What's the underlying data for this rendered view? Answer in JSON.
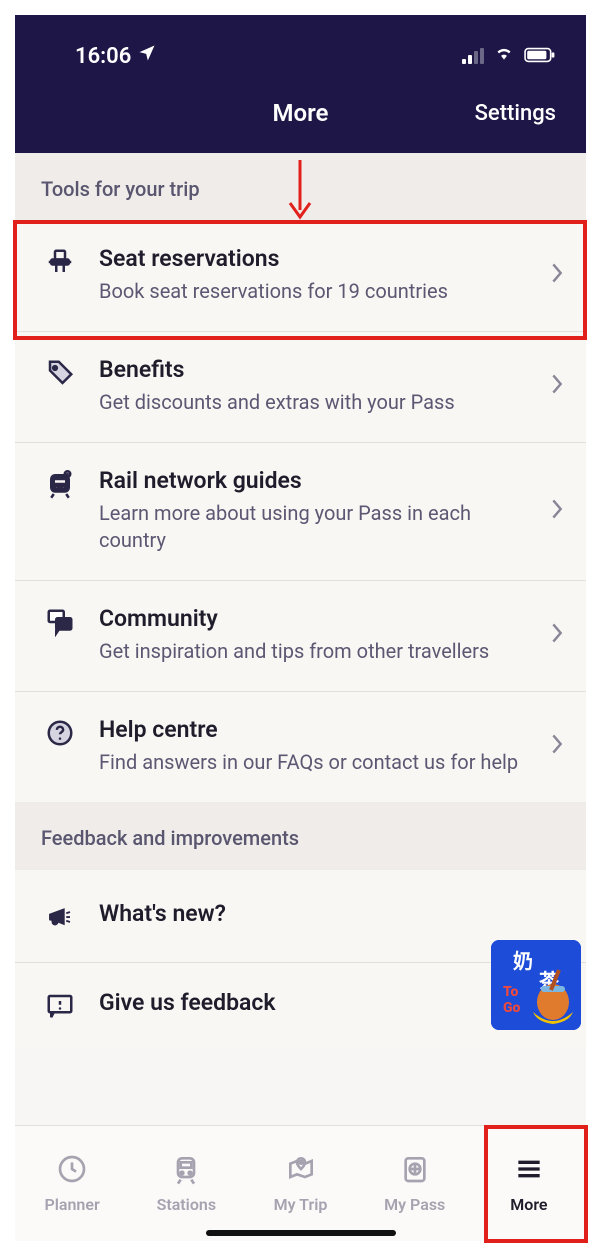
{
  "statusbar": {
    "time": "16:06"
  },
  "nav": {
    "title": "More",
    "settings": "Settings"
  },
  "sections": {
    "tools": {
      "title": "Tools for your trip",
      "items": [
        {
          "title": "Seat reservations",
          "sub": "Book seat reservations for 19 countries"
        },
        {
          "title": "Benefits",
          "sub": "Get discounts and extras with your Pass"
        },
        {
          "title": "Rail network guides",
          "sub": "Learn more about using your Pass in each country"
        },
        {
          "title": "Community",
          "sub": "Get inspiration and tips from other travellers"
        },
        {
          "title": "Help centre",
          "sub": "Find answers in our FAQs or contact us for help"
        }
      ]
    },
    "feedback": {
      "title": "Feedback and improvements",
      "items": [
        {
          "title": "What's new?"
        },
        {
          "title": "Give us feedback"
        }
      ]
    }
  },
  "tabs": {
    "planner": "Planner",
    "stations": "Stations",
    "mytrip": "My Trip",
    "mypass": "My Pass",
    "more": "More"
  }
}
